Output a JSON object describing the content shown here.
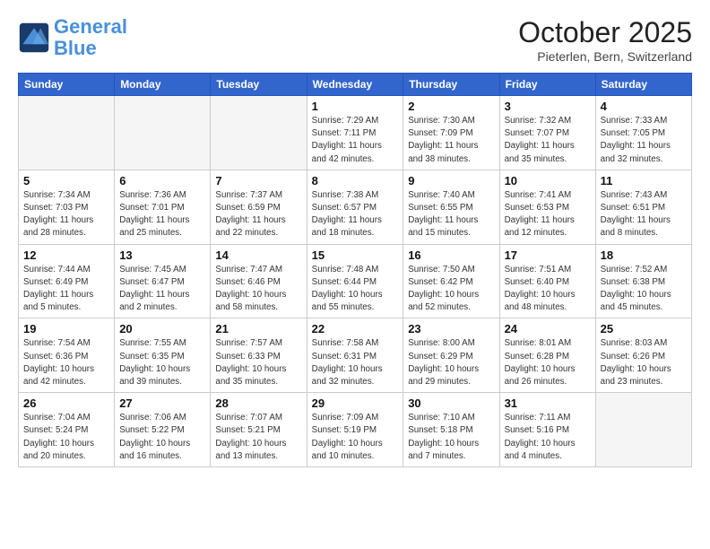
{
  "header": {
    "logo_line1": "General",
    "logo_line2": "Blue",
    "month": "October 2025",
    "location": "Pieterlen, Bern, Switzerland"
  },
  "weekdays": [
    "Sunday",
    "Monday",
    "Tuesday",
    "Wednesday",
    "Thursday",
    "Friday",
    "Saturday"
  ],
  "weeks": [
    [
      {
        "day": "",
        "info": ""
      },
      {
        "day": "",
        "info": ""
      },
      {
        "day": "",
        "info": ""
      },
      {
        "day": "1",
        "info": "Sunrise: 7:29 AM\nSunset: 7:11 PM\nDaylight: 11 hours\nand 42 minutes."
      },
      {
        "day": "2",
        "info": "Sunrise: 7:30 AM\nSunset: 7:09 PM\nDaylight: 11 hours\nand 38 minutes."
      },
      {
        "day": "3",
        "info": "Sunrise: 7:32 AM\nSunset: 7:07 PM\nDaylight: 11 hours\nand 35 minutes."
      },
      {
        "day": "4",
        "info": "Sunrise: 7:33 AM\nSunset: 7:05 PM\nDaylight: 11 hours\nand 32 minutes."
      }
    ],
    [
      {
        "day": "5",
        "info": "Sunrise: 7:34 AM\nSunset: 7:03 PM\nDaylight: 11 hours\nand 28 minutes."
      },
      {
        "day": "6",
        "info": "Sunrise: 7:36 AM\nSunset: 7:01 PM\nDaylight: 11 hours\nand 25 minutes."
      },
      {
        "day": "7",
        "info": "Sunrise: 7:37 AM\nSunset: 6:59 PM\nDaylight: 11 hours\nand 22 minutes."
      },
      {
        "day": "8",
        "info": "Sunrise: 7:38 AM\nSunset: 6:57 PM\nDaylight: 11 hours\nand 18 minutes."
      },
      {
        "day": "9",
        "info": "Sunrise: 7:40 AM\nSunset: 6:55 PM\nDaylight: 11 hours\nand 15 minutes."
      },
      {
        "day": "10",
        "info": "Sunrise: 7:41 AM\nSunset: 6:53 PM\nDaylight: 11 hours\nand 12 minutes."
      },
      {
        "day": "11",
        "info": "Sunrise: 7:43 AM\nSunset: 6:51 PM\nDaylight: 11 hours\nand 8 minutes."
      }
    ],
    [
      {
        "day": "12",
        "info": "Sunrise: 7:44 AM\nSunset: 6:49 PM\nDaylight: 11 hours\nand 5 minutes."
      },
      {
        "day": "13",
        "info": "Sunrise: 7:45 AM\nSunset: 6:47 PM\nDaylight: 11 hours\nand 2 minutes."
      },
      {
        "day": "14",
        "info": "Sunrise: 7:47 AM\nSunset: 6:46 PM\nDaylight: 10 hours\nand 58 minutes."
      },
      {
        "day": "15",
        "info": "Sunrise: 7:48 AM\nSunset: 6:44 PM\nDaylight: 10 hours\nand 55 minutes."
      },
      {
        "day": "16",
        "info": "Sunrise: 7:50 AM\nSunset: 6:42 PM\nDaylight: 10 hours\nand 52 minutes."
      },
      {
        "day": "17",
        "info": "Sunrise: 7:51 AM\nSunset: 6:40 PM\nDaylight: 10 hours\nand 48 minutes."
      },
      {
        "day": "18",
        "info": "Sunrise: 7:52 AM\nSunset: 6:38 PM\nDaylight: 10 hours\nand 45 minutes."
      }
    ],
    [
      {
        "day": "19",
        "info": "Sunrise: 7:54 AM\nSunset: 6:36 PM\nDaylight: 10 hours\nand 42 minutes."
      },
      {
        "day": "20",
        "info": "Sunrise: 7:55 AM\nSunset: 6:35 PM\nDaylight: 10 hours\nand 39 minutes."
      },
      {
        "day": "21",
        "info": "Sunrise: 7:57 AM\nSunset: 6:33 PM\nDaylight: 10 hours\nand 35 minutes."
      },
      {
        "day": "22",
        "info": "Sunrise: 7:58 AM\nSunset: 6:31 PM\nDaylight: 10 hours\nand 32 minutes."
      },
      {
        "day": "23",
        "info": "Sunrise: 8:00 AM\nSunset: 6:29 PM\nDaylight: 10 hours\nand 29 minutes."
      },
      {
        "day": "24",
        "info": "Sunrise: 8:01 AM\nSunset: 6:28 PM\nDaylight: 10 hours\nand 26 minutes."
      },
      {
        "day": "25",
        "info": "Sunrise: 8:03 AM\nSunset: 6:26 PM\nDaylight: 10 hours\nand 23 minutes."
      }
    ],
    [
      {
        "day": "26",
        "info": "Sunrise: 7:04 AM\nSunset: 5:24 PM\nDaylight: 10 hours\nand 20 minutes."
      },
      {
        "day": "27",
        "info": "Sunrise: 7:06 AM\nSunset: 5:22 PM\nDaylight: 10 hours\nand 16 minutes."
      },
      {
        "day": "28",
        "info": "Sunrise: 7:07 AM\nSunset: 5:21 PM\nDaylight: 10 hours\nand 13 minutes."
      },
      {
        "day": "29",
        "info": "Sunrise: 7:09 AM\nSunset: 5:19 PM\nDaylight: 10 hours\nand 10 minutes."
      },
      {
        "day": "30",
        "info": "Sunrise: 7:10 AM\nSunset: 5:18 PM\nDaylight: 10 hours\nand 7 minutes."
      },
      {
        "day": "31",
        "info": "Sunrise: 7:11 AM\nSunset: 5:16 PM\nDaylight: 10 hours\nand 4 minutes."
      },
      {
        "day": "",
        "info": ""
      }
    ]
  ]
}
